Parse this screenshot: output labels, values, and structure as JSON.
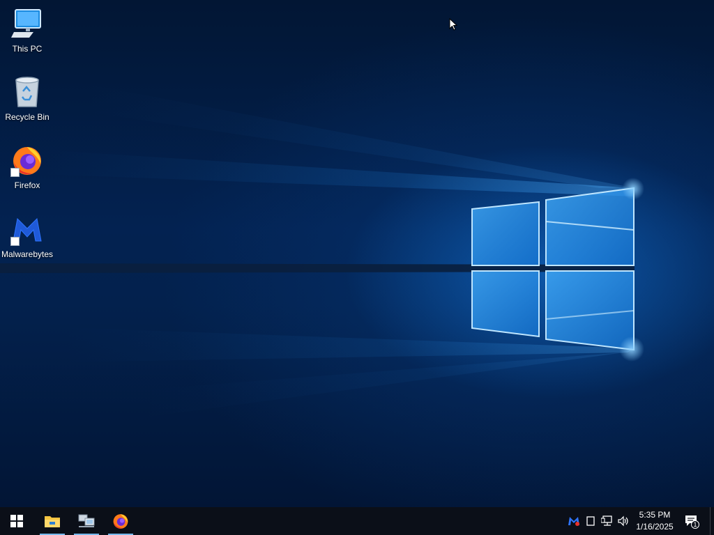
{
  "desktop": {
    "icons": [
      {
        "label": "This PC",
        "icon": "computer-monitor-icon"
      },
      {
        "label": "Recycle Bin",
        "icon": "recycle-bin-icon"
      },
      {
        "label": "Firefox",
        "icon": "firefox-icon"
      },
      {
        "label": "Malwarebytes",
        "icon": "malwarebytes-icon"
      }
    ],
    "wallpaper": "windows-10-light-logo"
  },
  "taskbar": {
    "pinned": [
      {
        "icon": "windows-start-icon",
        "active": false
      },
      {
        "icon": "file-explorer-icon",
        "active": true
      },
      {
        "icon": "network-computers-icon",
        "active": true
      },
      {
        "icon": "firefox-icon",
        "active": true
      }
    ],
    "tray": {
      "icons": [
        "malwarebytes-tray-icon",
        "tablet-icon",
        "network-icon",
        "volume-icon"
      ],
      "time": "5:35 PM",
      "date": "1/16/2025",
      "notifications_count": "1"
    }
  },
  "colors": {
    "taskbar": "#0b0f18",
    "accent_blue": "#76b9ed",
    "wallpaper_dark": "#03214d"
  }
}
